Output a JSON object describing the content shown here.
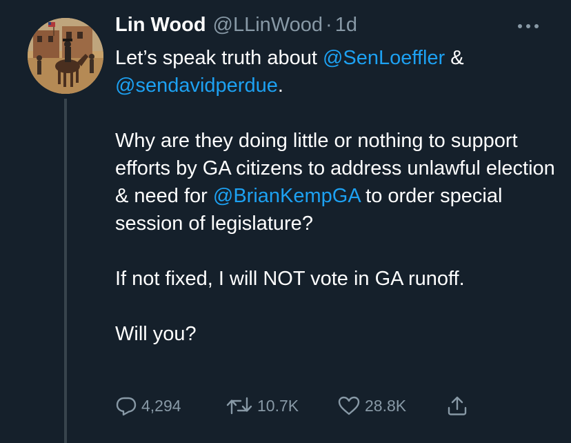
{
  "tweet": {
    "display_name": "Lin Wood",
    "handle": "@LLinWood",
    "separator": "·",
    "time": "1d",
    "line1_text": "Let’s speak truth about ",
    "mention1": "@SenLoeffler",
    "line1_end": " &",
    "mention2": "@sendavidperdue",
    "line2_end": ".",
    "para2_text": "Why are they doing little or nothing to support efforts by GA citizens to address unlawful election & need for ",
    "mention3": "@BrianKempGA",
    "para2_end": " to order special session of legislature?",
    "para3": "If not fixed, I will NOT vote in GA runoff.",
    "para4": "Will you?"
  },
  "actions": {
    "reply_count": "4,294",
    "retweet_count": "10.7K",
    "like_count": "28.8K"
  },
  "colors": {
    "background": "#15202b",
    "text": "#ffffff",
    "muted": "#8899a6",
    "link": "#1da1f2"
  },
  "icons": {
    "more": "more-icon",
    "reply": "reply-icon",
    "retweet": "retweet-icon",
    "like": "heart-icon",
    "share": "share-icon"
  }
}
